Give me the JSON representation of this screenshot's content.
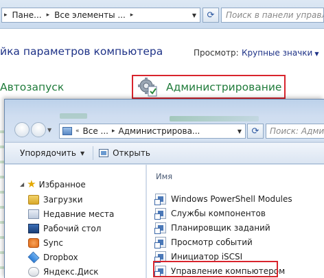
{
  "control_panel": {
    "address": {
      "segments": [
        "Пане...",
        "Все элементы ..."
      ],
      "search_placeholder": "Поиск в панели управления"
    },
    "title": "йка параметров компьютера",
    "view_label": "Просмотр:",
    "view_value": "Крупные значки",
    "items": {
      "autorun": "Автозапуск",
      "administration": "Администрирование"
    }
  },
  "explorer": {
    "address": {
      "segments": [
        "Все ...",
        "Администрирова..."
      ],
      "search_placeholder": "Поиск: Админис"
    },
    "toolbar": {
      "organize": "Упорядочить",
      "open": "Открыть"
    },
    "nav": {
      "favorites": "Избранное",
      "items": [
        "Загрузки",
        "Недавние места",
        "Рабочий стол",
        "Sync",
        "Dropbox",
        "Яндекс.Диск"
      ]
    },
    "column_header": "Имя",
    "files": [
      "Windows PowerShell Modules",
      "Службы компонентов",
      "Планировщик заданий",
      "Просмотр событий",
      "Инициатор iSCSI",
      "Управление компьютером"
    ]
  },
  "colors": {
    "highlight": "#d8242c",
    "link_green": "#1f7b3a",
    "title_blue": "#1e3287"
  }
}
